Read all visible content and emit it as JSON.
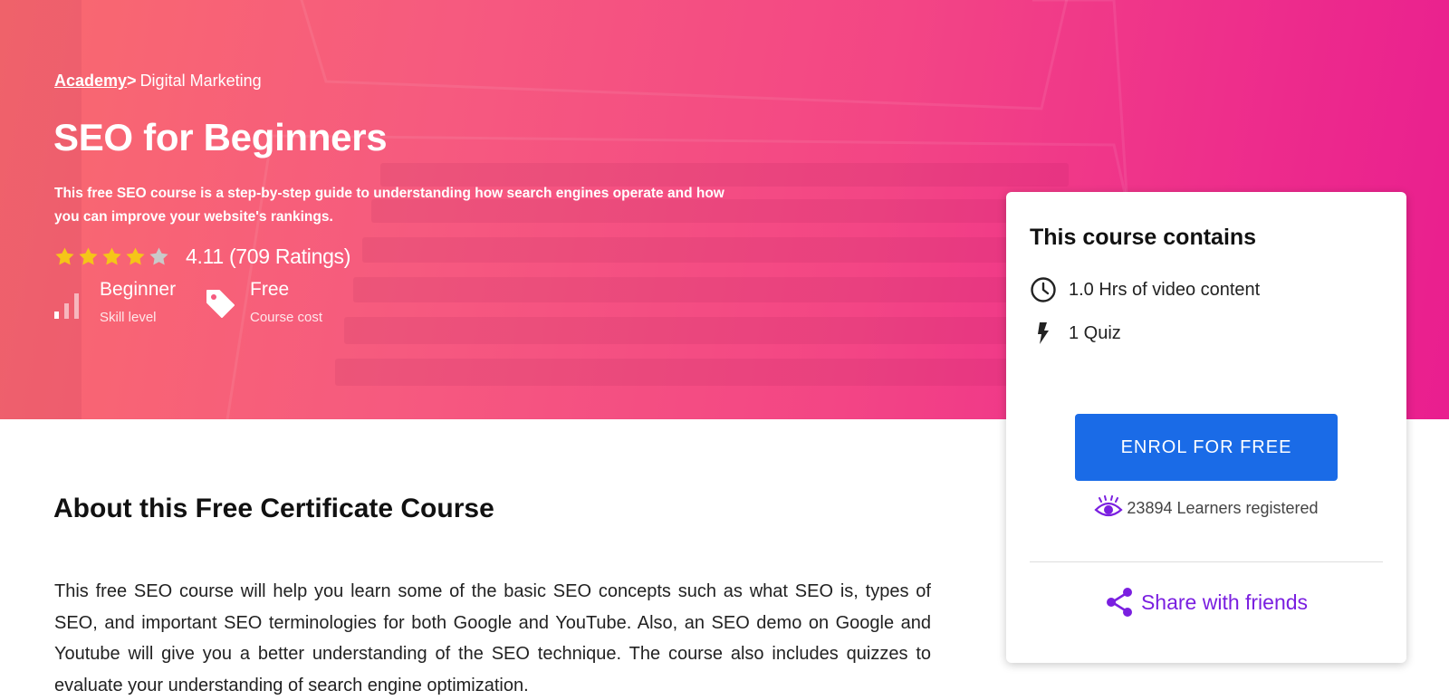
{
  "breadcrumb": {
    "root": "Academy",
    "separator": ">",
    "current": "Digital Marketing"
  },
  "course": {
    "title": "SEO for Beginners",
    "description": "This free SEO course is a step-by-step guide to understanding how search engines operate and how you can improve your website's rankings.",
    "rating": {
      "stars_filled": 4,
      "stars_total": 5,
      "text": "4.11 (709 Ratings)"
    },
    "level": {
      "value": "Beginner",
      "label": "Skill level",
      "icon": "skill-level-bars-icon"
    },
    "cost": {
      "value": "Free",
      "label": "Course cost",
      "icon": "price-tag-icon"
    }
  },
  "about": {
    "title": "About this Free Certificate Course",
    "body": "This free SEO course will help you learn some of the basic SEO concepts such as what SEO is, types of SEO, and important SEO terminologies for both Google and YouTube. Also, an SEO demo on Google and Youtube will give you a better understanding of the SEO technique. The course also includes quizzes to evaluate your understanding of search engine optimization."
  },
  "card": {
    "title": "This course contains",
    "items": [
      {
        "icon": "clock-icon",
        "text": "1.0 Hrs of video content"
      },
      {
        "icon": "lightning-icon",
        "text": "1 Quiz"
      }
    ],
    "enrol_label": "ENROL FOR FREE",
    "learners": {
      "icon": "eye-icon",
      "text": "23894 Learners registered"
    },
    "share": {
      "icon": "share-icon",
      "label": "Share with friends"
    }
  },
  "colors": {
    "hero_gradient_start": "#f96a6e",
    "hero_gradient_end": "#e91e8f",
    "star_filled": "#f5c518",
    "star_empty": "#c9c9c9",
    "enrol_button": "#1a6be7",
    "accent_purple": "#7a1fe0"
  }
}
